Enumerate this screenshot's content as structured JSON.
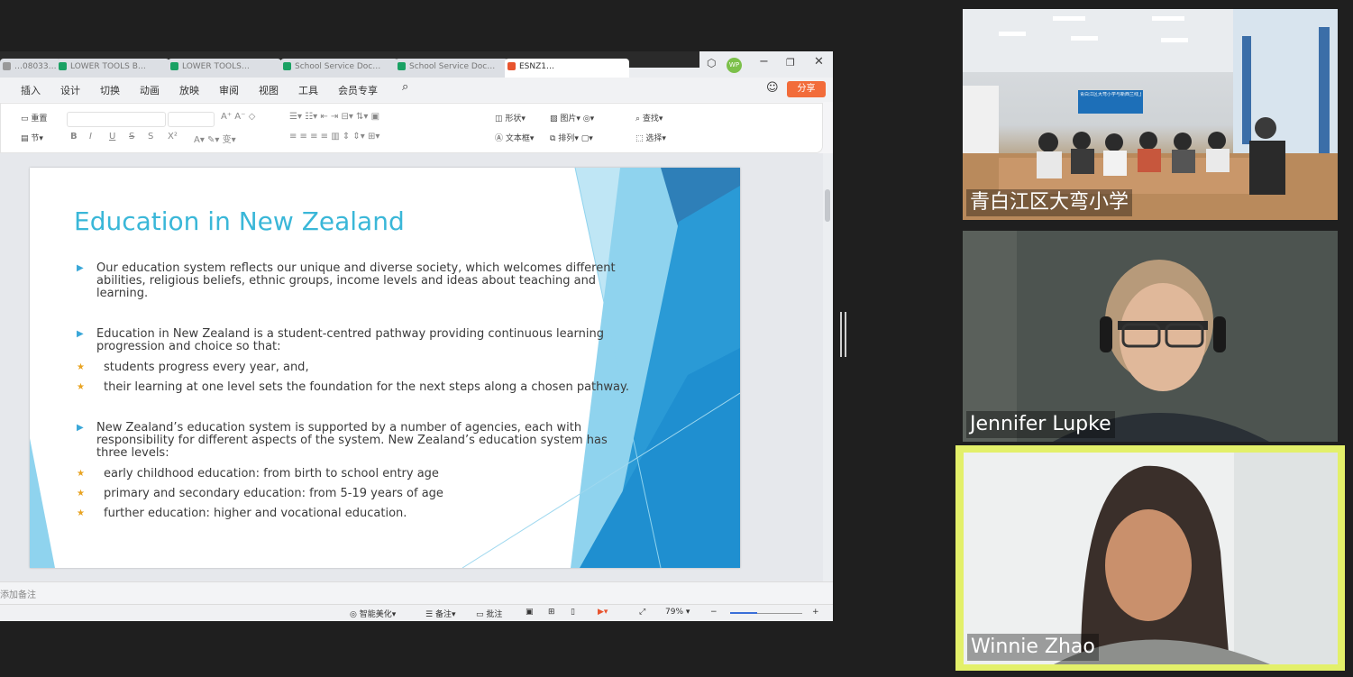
{
  "wps": {
    "tabs": [
      "…08033…",
      "LOWER TOOLS B…",
      "LOWER TOOLS…",
      "School Service Doc…",
      "School Service Doc…",
      "ESNZ1…"
    ],
    "user_initials": "WP",
    "menu": [
      "插入",
      "设计",
      "切换",
      "动画",
      "放映",
      "审阅",
      "视图",
      "工具",
      "会员专享"
    ],
    "share_label": "分享",
    "ribbon": {
      "reset": "重置",
      "section": "节",
      "shape": "形状",
      "picture": "图片",
      "textbox": "文本框",
      "arrange": "排列",
      "find": "查找",
      "select": "选择",
      "bold": "B",
      "italic": "I",
      "underline": "U",
      "strike": "S",
      "shadow": "S",
      "superscript": "X²"
    }
  },
  "slide": {
    "title": "Education in New Zealand",
    "bullets": [
      {
        "level": 1,
        "text_lines": [
          "Our education system reflects our unique and diverse society, which welcomes different",
          "abilities, religious beliefs, ethnic groups, income levels and ideas about teaching and",
          "learning."
        ]
      },
      {
        "level": 1,
        "text_lines": [
          "Education in New Zealand is a student-centred pathway providing continuous learning",
          "progression and choice so that:"
        ]
      },
      {
        "level": 2,
        "text_lines": [
          "students progress every year, and,"
        ]
      },
      {
        "level": 2,
        "text_lines": [
          "their learning at one level sets the foundation for the next steps along a chosen pathway."
        ]
      },
      {
        "level": 1,
        "text_lines": [
          "New Zealand’s education system is supported by a number of agencies, each with",
          "responsibility for different aspects of the system. New Zealand’s education system has",
          "three levels:"
        ]
      },
      {
        "level": 2,
        "text_lines": [
          "early childhood education: from birth to school entry age"
        ]
      },
      {
        "level": 2,
        "text_lines": [
          "primary and secondary education: from 5-19 years of age"
        ]
      },
      {
        "level": 2,
        "text_lines": [
          "further education: higher and vocational education."
        ]
      }
    ]
  },
  "notes_placeholder": "添加备注",
  "status": {
    "beautify": "智能美化",
    "notes": "备注",
    "comments": "批注",
    "zoom": "79%"
  },
  "participants": [
    {
      "name": "青白江区大弯小学",
      "banner": "青白江区大弯小学与新西兰线上研讨会"
    },
    {
      "name": "Jennifer Lupke"
    },
    {
      "name": "Winnie Zhao",
      "active_speaker": true
    }
  ],
  "colors": {
    "accent_title": "#3ab7d8",
    "share_button": "#f26c3a",
    "active_speaker_border": "#e3f06a"
  }
}
